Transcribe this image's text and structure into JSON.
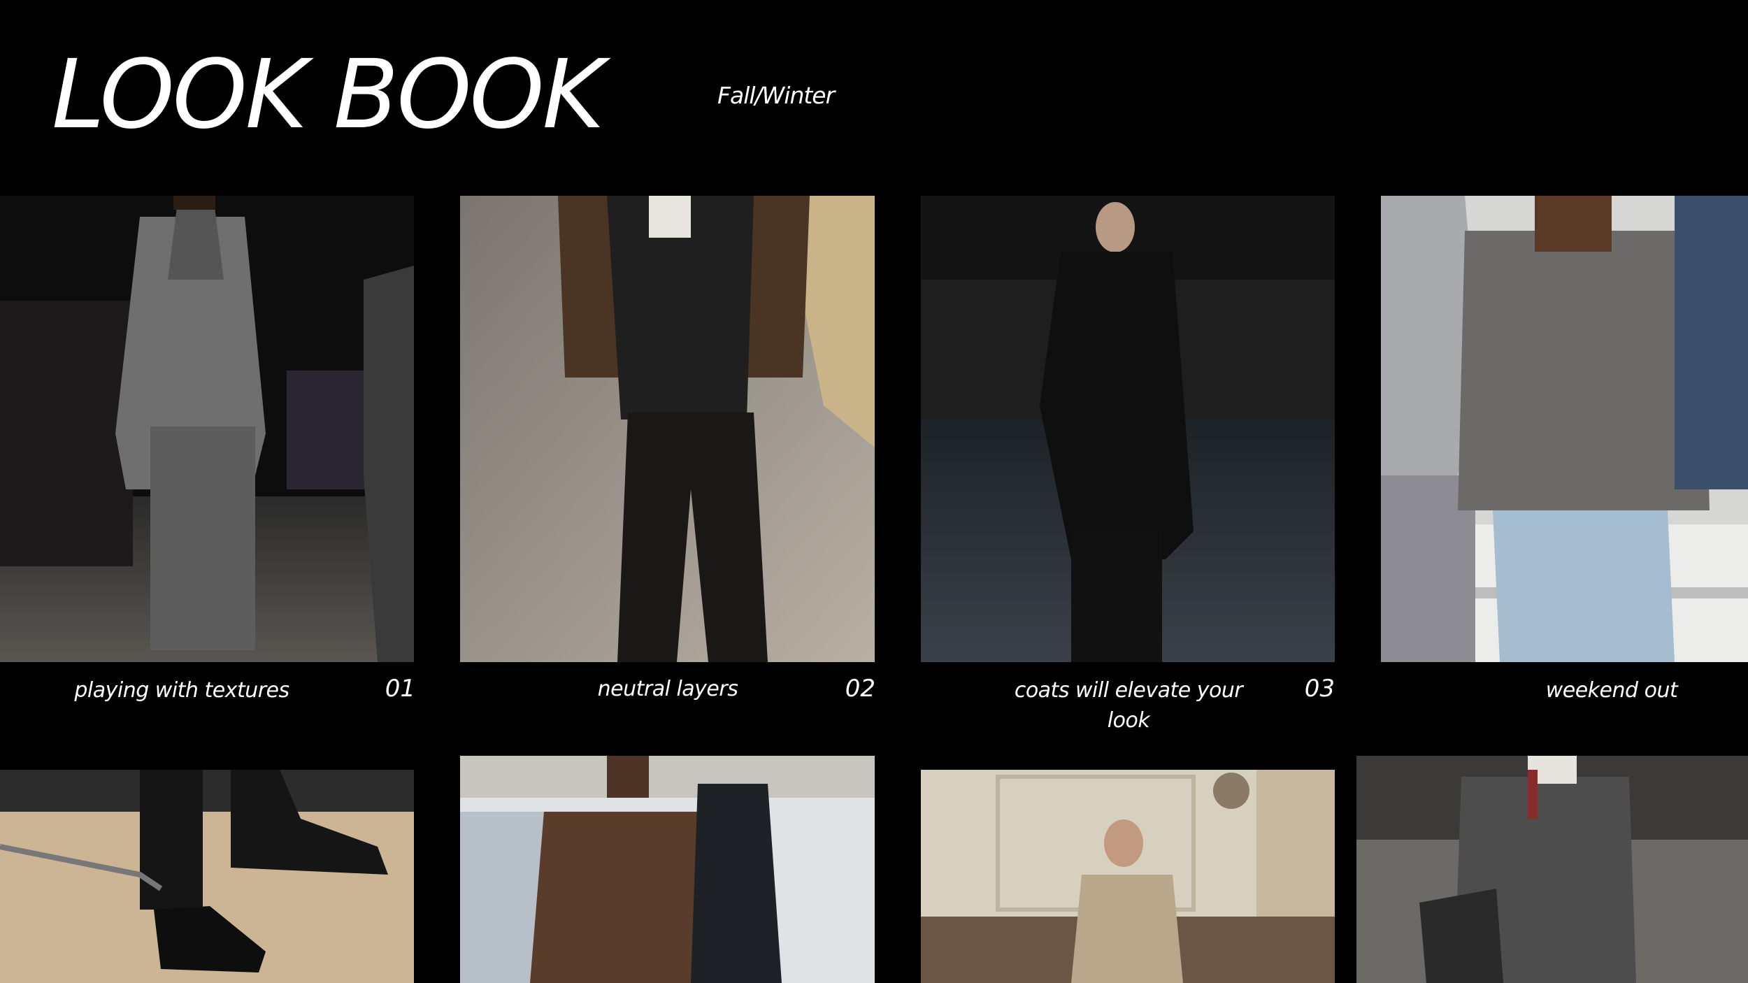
{
  "header": {
    "title": "LOOK BOOK",
    "subtitle": "Fall/Winter"
  },
  "looks": [
    {
      "caption": "playing with textures",
      "number": "01",
      "image": "runway-grey-leather-jacket-photo"
    },
    {
      "caption": "neutral layers",
      "number": "02",
      "image": "brown-jacket-black-blazer-street-photo"
    },
    {
      "caption": "coats will elevate your look",
      "number": "03",
      "image": "runway-black-overcoat-photo"
    },
    {
      "caption": "weekend out",
      "number": "",
      "image": "grey-cardigan-light-jeans-street-photo"
    }
  ],
  "second_row": [
    {
      "image": "black-monk-strap-shoes-photo"
    },
    {
      "image": "brown-overshirt-crossbody-bag-photo"
    },
    {
      "image": "sweater-vest-man-on-sofa-photo"
    },
    {
      "image": "grey-knit-sweater-tie-photo"
    }
  ]
}
